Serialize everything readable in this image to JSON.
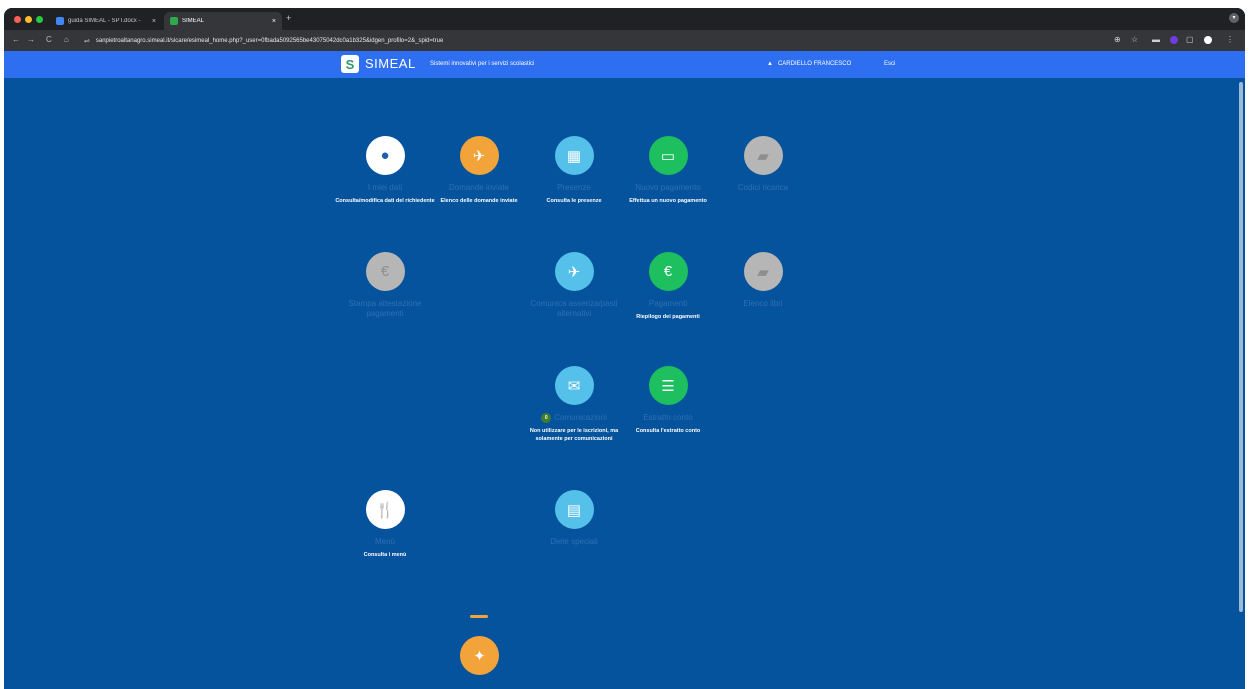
{
  "browser": {
    "tabs": [
      {
        "title": "guida SIMEAL - SPT.docx - ",
        "close": "×"
      },
      {
        "title": "SIMEAL",
        "close": "×"
      }
    ],
    "new_tab": "+",
    "url": "sanpietroaltanagro.simeal.it/sicare/esimeal_home.php?_user=0fbada5092565be43075042dc0a1b325&idgen_profilo=2&_spid=true",
    "nav": {
      "back": "←",
      "forward": "→",
      "reload": "C",
      "home": "⌂",
      "site_info": "⇌"
    },
    "extensions": [
      "⊕",
      "☆",
      "▬",
      "▢",
      "⋮"
    ]
  },
  "header": {
    "logo_letter": "S",
    "brand": "SIMEAL",
    "tagline": "Sistemi innovativi per i servizi scolastici",
    "user_icon": "▲",
    "user_name": "CARDIELLO FRANCESCO",
    "logout": "Esci"
  },
  "tiles": [
    {
      "id": "anagrafica",
      "icon": "user-icon",
      "glyph": "●",
      "color": "white",
      "title": "I miei dati",
      "desc": "Consulta/modifica dati del richiedente"
    },
    {
      "id": "domande",
      "icon": "paper-plane-icon",
      "glyph": "✈",
      "color": "orange",
      "title": "Domande inviate",
      "desc": "Elenco delle domande inviate"
    },
    {
      "id": "presenze",
      "icon": "calendar-icon",
      "glyph": "▦",
      "color": "cyan",
      "title": "Presenze",
      "desc": "Consulta le presenze"
    },
    {
      "id": "nuovo-pagamento",
      "icon": "credit-card-icon",
      "glyph": "▭",
      "color": "green",
      "title": "Nuovo pagamento",
      "desc": "Effettua un nuovo pagamento"
    },
    {
      "id": "codice-ricarica",
      "icon": "book-icon",
      "glyph": "▰",
      "color": "grey",
      "title": "Codici ricarica",
      "desc": ""
    },
    {
      "id": "stampa-attestazione",
      "icon": "euro-icon",
      "glyph": "€",
      "color": "grey",
      "title": "Stampa attestazione pagamenti",
      "desc": ""
    },
    {
      "id": "comunica",
      "icon": "paper-plane-icon",
      "glyph": "✈",
      "color": "cyan",
      "title": "Comunica assenza/pasti alternativi",
      "desc": ""
    },
    {
      "id": "pagamenti",
      "icon": "euro-icon",
      "glyph": "€",
      "color": "green",
      "title": "Pagamenti",
      "desc": "Riepilogo dei pagamenti"
    },
    {
      "id": "libro",
      "icon": "book-icon",
      "glyph": "▰",
      "color": "grey",
      "title": "Elenco libri",
      "desc": ""
    },
    {
      "id": "comunicazioni",
      "icon": "envelope-icon",
      "glyph": "✉",
      "color": "cyan",
      "title": "Comunicazioni",
      "badge": "0",
      "desc": "Non utilizzare per le iscrizioni, ma solamente per comunicazioni"
    },
    {
      "id": "estratto-conto",
      "icon": "list-icon",
      "glyph": "☰",
      "color": "green",
      "title": "Estratto conto",
      "desc": "Consulta l'estratto conto"
    },
    {
      "id": "menu",
      "icon": "cutlery-icon",
      "glyph": "🍴",
      "color": "white",
      "title": "Menù",
      "desc": "Consulta i menù"
    },
    {
      "id": "diete",
      "icon": "document-icon",
      "glyph": "▤",
      "color": "cyan",
      "title": "Diete speciali",
      "desc": ""
    }
  ],
  "floating": {
    "icon": "accessibility-icon",
    "glyph": "✦"
  }
}
